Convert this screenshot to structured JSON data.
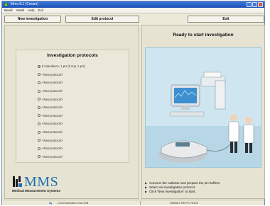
{
  "window": {
    "title": "Mms 8.1 (Cream)"
  },
  "menu": {
    "items": [
      "Beeld",
      "Instell",
      "Hulp",
      "Exit"
    ]
  },
  "toolbar": {
    "new_investigation": "New investigation",
    "edit_protocol": "Edit protocol",
    "exit": "Exit"
  },
  "protocols": {
    "heading": "Investigation protocols",
    "items": [
      {
        "label": "8 impedance, 1 pH (5 imp, 1 pH)",
        "selected": true
      },
      {
        "label": "<New protocol>",
        "selected": false
      },
      {
        "label": "<New protocol>",
        "selected": false
      },
      {
        "label": "<New protocol>",
        "selected": false
      },
      {
        "label": "<New protocol>",
        "selected": false
      },
      {
        "label": "<New protocol>",
        "selected": false
      },
      {
        "label": "<New protocol>",
        "selected": false
      },
      {
        "label": "<New protocol>",
        "selected": false
      },
      {
        "label": "<New protocol>",
        "selected": false
      },
      {
        "label": "<New protocol>",
        "selected": false
      },
      {
        "label": "<New protocol>",
        "selected": false
      },
      {
        "label": "<New protocol>",
        "selected": false
      }
    ]
  },
  "logo": {
    "text": "MMS",
    "subtitle": "Medical Measurement Systems"
  },
  "status_panel": {
    "title": "Ready to start investigation",
    "instructions": [
      "Connect the catheter and prepare the pH buffers.",
      "Select an investigation protocol.",
      "Click 'New investigation' to start."
    ]
  },
  "statusbar": {
    "connection": "Communication via USB",
    "serial": "SN5061 REVPI-78101"
  },
  "colors": {
    "accent": "#1f6fb0",
    "titlebar": "#1d52b8",
    "panel": "#e6e3d2",
    "illustration_bg": "#cfe6f1"
  }
}
